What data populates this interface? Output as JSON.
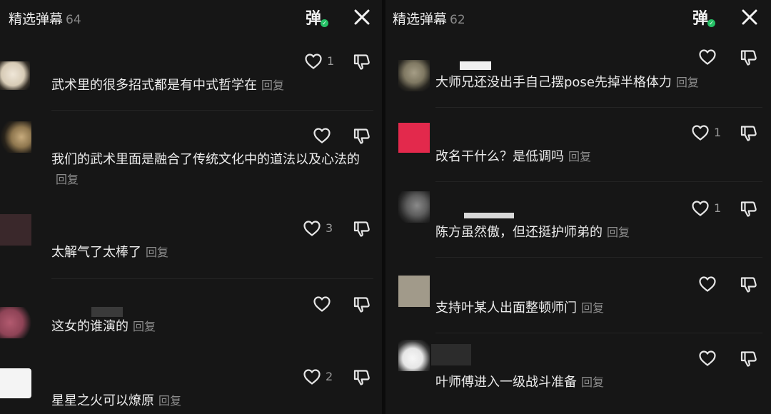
{
  "left_panel": {
    "title": "精选弹幕",
    "count": "64",
    "danmu_icon": "弹",
    "comments": [
      {
        "text": "武术里的很多招式都是有中式哲学在",
        "reply": "回复",
        "likes": "1"
      },
      {
        "text": "我们的武术里面是融合了传统文化中的道法以及心法的",
        "reply": "回复",
        "likes": ""
      },
      {
        "text": "太解气了太棒了",
        "reply": "回复",
        "likes": "3"
      },
      {
        "text": "这女的谁演的",
        "reply": "回复",
        "likes": ""
      },
      {
        "text": "星星之火可以燎原",
        "reply": "回复",
        "likes": "2"
      }
    ]
  },
  "right_panel": {
    "title": "精选弹幕",
    "count": "62",
    "danmu_icon": "弹",
    "comments": [
      {
        "text": "大师兄还没出手自己摆pose先掉半格体力",
        "reply": "回复",
        "likes": ""
      },
      {
        "text": "改名干什么？是低调吗",
        "reply": "回复",
        "likes": "1"
      },
      {
        "text": "陈方虽然傲，但还挺护师弟的",
        "reply": "回复",
        "likes": "1"
      },
      {
        "text": "支持叶某人出面整顿师门",
        "reply": "回复",
        "likes": ""
      },
      {
        "text": "叶师傅进入一级战斗准备",
        "reply": "回复",
        "likes": ""
      }
    ]
  },
  "icons": {
    "like": "heart-outline-icon",
    "dislike": "thumbs-down-icon",
    "close": "close-icon",
    "danmu": "danmu-toggle-icon",
    "danmu_check": "check-icon"
  },
  "colors": {
    "background": "#161616",
    "text": "#ececec",
    "secondary": "#8c8c8c",
    "check_green": "#25c166"
  }
}
